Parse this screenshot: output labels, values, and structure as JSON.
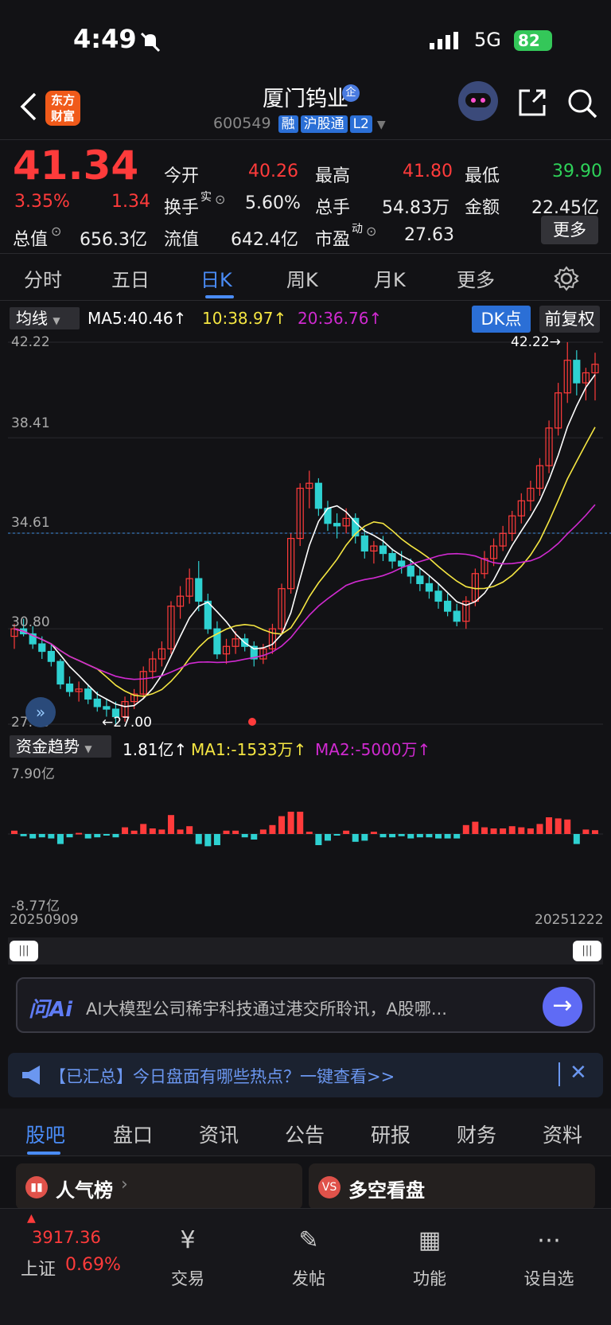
{
  "status": {
    "time": "4:49",
    "network": "5G",
    "battery": "82"
  },
  "header": {
    "title": "厦门钨业",
    "code": "600549",
    "tags": [
      "融",
      "沪股通",
      "L2"
    ],
    "brand": "东方财富"
  },
  "quote": {
    "price": "41.34",
    "change_pct": "3.35%",
    "change": "1.34",
    "open_label": "今开",
    "open": "40.26",
    "high_label": "最高",
    "high": "41.80",
    "low_label": "最低",
    "low": "39.90",
    "turnover_label": "换手",
    "turnover_sup": "实",
    "turnover": "5.60%",
    "volume_label": "总手",
    "volume": "54.83万",
    "amount_label": "金额",
    "amount": "22.45亿",
    "total_cap_label": "总值",
    "total_cap": "656.3亿",
    "float_cap_label": "流值",
    "float_cap": "642.4亿",
    "pe_label": "市盈",
    "pe_sup": "动",
    "pe": "27.63",
    "more": "更多"
  },
  "tabs": [
    "分时",
    "五日",
    "日K",
    "周K",
    "月K",
    "更多"
  ],
  "ma_bar": {
    "selector": "均线",
    "ma5": "MA5:40.46↑",
    "ma10": "10:38.97↑",
    "ma20": "20:36.76↑",
    "dk": "DK点",
    "adjust": "前复权"
  },
  "price_axis": [
    "42.22",
    "38.41",
    "34.61",
    "30.80",
    "27.00"
  ],
  "high_marker": "42.22→",
  "low_marker": "←27.00",
  "fund_bar": {
    "selector": "资金趋势",
    "value": "1.81亿↑",
    "ma1": "MA1:-1533万↑",
    "ma2": "MA2:-5000万↑",
    "top": "7.90亿",
    "bottom": "-8.77亿"
  },
  "dates": {
    "start": "20250909",
    "end": "20251222"
  },
  "ai": {
    "logo": "问Ai",
    "text": "AI大模型公司稀宇科技通过港交所聆讯，A股哪..."
  },
  "notice": {
    "text": "【已汇总】今日盘面有哪些热点？一键查看>>"
  },
  "subtabs": [
    "股吧",
    "盘口",
    "资讯",
    "公告",
    "研报",
    "财务",
    "资料"
  ],
  "cards": [
    "人气榜",
    "多空看盘"
  ],
  "bottom": {
    "index_value": "3917.36",
    "index_name": "上证",
    "index_pct": "0.69%",
    "items": [
      "交易",
      "发帖",
      "功能",
      "设自选"
    ]
  },
  "colors": {
    "up": "#ff3b3b",
    "down": "#2ed1d1",
    "ma5": "#ffffff",
    "ma10": "#f5e642",
    "ma20": "#d02ad0",
    "accent": "#4a8cf7"
  },
  "chart_data": {
    "type": "candlestick",
    "ylim": [
      27.0,
      42.22
    ],
    "candles": [
      [
        30.5,
        31.0,
        30.0,
        30.8
      ],
      [
        30.8,
        31.2,
        30.5,
        30.6
      ],
      [
        30.6,
        30.9,
        30.0,
        30.2
      ],
      [
        30.2,
        30.5,
        29.6,
        29.9
      ],
      [
        29.9,
        30.2,
        29.3,
        29.5
      ],
      [
        29.5,
        29.6,
        28.4,
        28.6
      ],
      [
        28.6,
        28.9,
        28.1,
        28.3
      ],
      [
        28.3,
        28.7,
        27.9,
        28.4
      ],
      [
        28.4,
        28.6,
        27.8,
        28.0
      ],
      [
        28.0,
        28.3,
        27.5,
        27.7
      ],
      [
        27.7,
        28.0,
        27.3,
        27.6
      ],
      [
        27.6,
        27.9,
        27.0,
        27.3
      ],
      [
        27.3,
        28.1,
        27.1,
        27.9
      ],
      [
        27.9,
        28.4,
        27.6,
        28.2
      ],
      [
        28.2,
        29.3,
        28.0,
        29.1
      ],
      [
        29.1,
        29.9,
        28.8,
        29.6
      ],
      [
        29.6,
        30.3,
        29.3,
        30.0
      ],
      [
        30.0,
        31.9,
        29.8,
        31.7
      ],
      [
        31.7,
        32.5,
        31.2,
        32.1
      ],
      [
        32.1,
        33.2,
        31.8,
        32.8
      ],
      [
        32.8,
        33.5,
        31.5,
        31.9
      ],
      [
        31.9,
        32.2,
        30.6,
        30.8
      ],
      [
        30.8,
        31.1,
        29.6,
        29.8
      ],
      [
        29.8,
        30.4,
        29.4,
        30.1
      ],
      [
        30.1,
        30.7,
        29.8,
        30.4
      ],
      [
        30.4,
        30.6,
        29.9,
        30.1
      ],
      [
        30.1,
        30.3,
        29.3,
        29.6
      ],
      [
        29.6,
        30.2,
        29.4,
        30.0
      ],
      [
        30.0,
        31.0,
        29.8,
        30.8
      ],
      [
        30.8,
        32.6,
        30.6,
        32.4
      ],
      [
        32.4,
        34.6,
        32.2,
        34.4
      ],
      [
        34.4,
        36.6,
        34.1,
        36.4
      ],
      [
        36.4,
        37.1,
        35.6,
        36.6
      ],
      [
        36.6,
        36.8,
        35.3,
        35.6
      ],
      [
        35.6,
        35.9,
        34.7,
        35.0
      ],
      [
        35.0,
        35.4,
        34.4,
        34.9
      ],
      [
        34.9,
        35.6,
        34.6,
        35.2
      ],
      [
        35.2,
        35.4,
        34.2,
        34.5
      ],
      [
        34.5,
        34.8,
        33.6,
        33.9
      ],
      [
        33.9,
        34.3,
        33.4,
        34.1
      ],
      [
        34.1,
        34.5,
        33.5,
        33.8
      ],
      [
        33.8,
        34.0,
        33.2,
        33.5
      ],
      [
        33.5,
        33.9,
        33.0,
        33.3
      ],
      [
        33.3,
        33.6,
        32.6,
        32.9
      ],
      [
        32.9,
        33.2,
        32.3,
        32.6
      ],
      [
        32.6,
        32.9,
        32.0,
        32.3
      ],
      [
        32.3,
        32.6,
        31.6,
        31.9
      ],
      [
        31.9,
        32.2,
        31.3,
        31.5
      ],
      [
        31.5,
        31.8,
        30.9,
        31.1
      ],
      [
        31.1,
        32.1,
        30.8,
        31.9
      ],
      [
        31.9,
        33.2,
        31.7,
        33.0
      ],
      [
        33.0,
        33.9,
        32.8,
        33.6
      ],
      [
        33.6,
        34.4,
        33.3,
        34.1
      ],
      [
        34.1,
        34.9,
        33.9,
        34.6
      ],
      [
        34.6,
        35.5,
        34.3,
        35.3
      ],
      [
        35.3,
        36.2,
        35.0,
        35.9
      ],
      [
        35.9,
        36.7,
        35.5,
        36.4
      ],
      [
        36.4,
        37.6,
        36.1,
        37.3
      ],
      [
        37.3,
        39.1,
        37.0,
        38.8
      ],
      [
        38.8,
        40.6,
        38.5,
        40.2
      ],
      [
        40.2,
        42.22,
        39.8,
        41.5
      ],
      [
        41.5,
        41.9,
        40.1,
        40.6
      ],
      [
        40.6,
        41.2,
        39.9,
        41.0
      ],
      [
        41.0,
        41.8,
        39.9,
        41.34
      ]
    ],
    "ma5_end": 40.46,
    "ma10_end": 38.97,
    "ma20_end": 36.76
  }
}
